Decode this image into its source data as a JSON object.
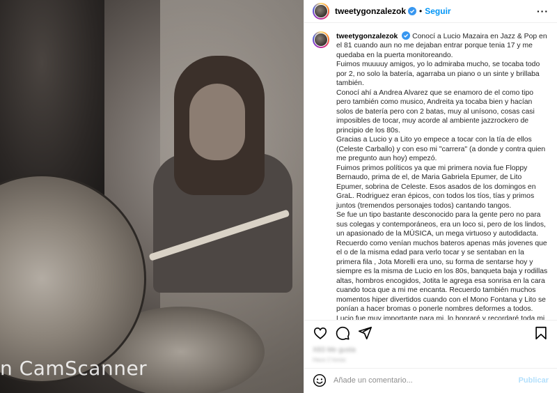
{
  "photo": {
    "watermark": "n CamScanner"
  },
  "header": {
    "username": "tweetygonzalezok",
    "separator": "•",
    "follow_label": "Seguir",
    "more_label": "···"
  },
  "caption": {
    "username": "tweetygonzalezok",
    "paragraphs": [
      "Conocí a Lucio Mazaira en Jazz & Pop en el 81 cuando aun no me dejaban entrar porque tenia 17 y me quedaba en la puerta monitoreando.",
      "Fuimos muuuuy amigos, yo lo admiraba mucho, se tocaba todo por 2, no solo la batería, agarraba un piano o un sinte y brillaba también.",
      "Conocí ahí a Andrea Alvarez que se enamoro de el como tipo pero también como musico, Andreita ya tocaba bien y hacían solos de batería pero con 2 batas, muy al unísono, cosas casi imposibles de tocar, muy acorde al ambiente jazzrockero de principio de los 80s.",
      "Gracias a Lucio y a Lito yo empece a tocar con la tía de ellos (Celeste Carballo) y con eso mi \"carrera\" (a donde y contra quien me pregunto aun hoy) empezó.",
      "Fuimos primos políticos ya que mi primera novia fue Floppy Bernaudo, prima de el, de Maria Gabriela Epumer, de Lito Epumer, sobrina de Celeste. Esos asados de los domingos en GraL. Rodriguez eran épicos, con todos los tíos, tías y primos juntos (tremendos personajes todos) cantando tangos.",
      "Se fue un tipo bastante desconocido para la gente pero no para sus colegas y contemporáneos, era un loco si, pero de los lindos, un apasionado de la MÚSICA, un mega virtuoso y autodidacta.",
      "Recuerdo como venían muchos bateros apenas más jovenes que el o de la misma edad para verlo tocar y se sentaban en la primera fila , Jota Morelli era uno, su forma de sentarse hoy y siempre es la misma de Lucio en los 80s, banqueta baja y rodillas altas, hombros encogidos, Jotita le agrega esa sonrisa en la cara cuando toca que a mi me encanta. Recuerdo también muchos momentos hiper divertidos cuando con el Mono Fontana y Lito se ponían a hacer bromas o ponerle nombres deformes a todos.",
      "Lucio fue muy importante para mi, lo honraré y recordaré toda mi vida."
    ]
  },
  "stats": {
    "likes": "X83 Me gusta",
    "date": "Hace 2 horas"
  },
  "comment": {
    "placeholder": "Añade un comentario...",
    "publish_label": "Publicar"
  },
  "colors": {
    "accent": "#0095f6",
    "publish_disabled": "#b2dffc",
    "verified": "#3897f0"
  }
}
